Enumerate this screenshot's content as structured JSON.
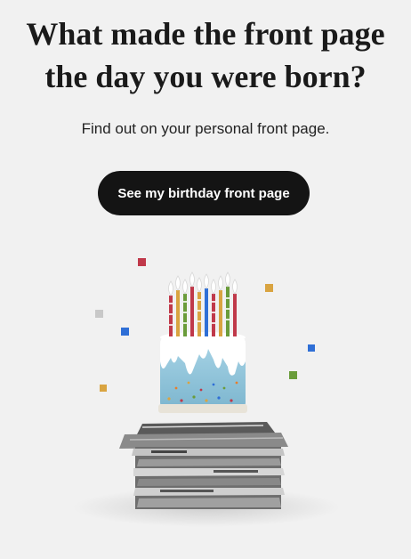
{
  "hero": {
    "headline_line1": "What made the front page",
    "headline_line2": "the day you were born?",
    "subheadline": "Find out on your personal front page.",
    "cta_label": "See my birthday front page"
  },
  "illustration": {
    "subject": "birthday-cake-on-newspaper-stack",
    "colors": {
      "frosting": "#8fc5dc",
      "drip": "#ffffff",
      "newspaper": "#7a7a7a",
      "confetti_red": "#c0394a",
      "confetti_blue": "#2f6fd6",
      "confetti_gold": "#d9a441",
      "confetti_green": "#6a9c3a",
      "confetti_gray": "#c8c8c8"
    }
  }
}
